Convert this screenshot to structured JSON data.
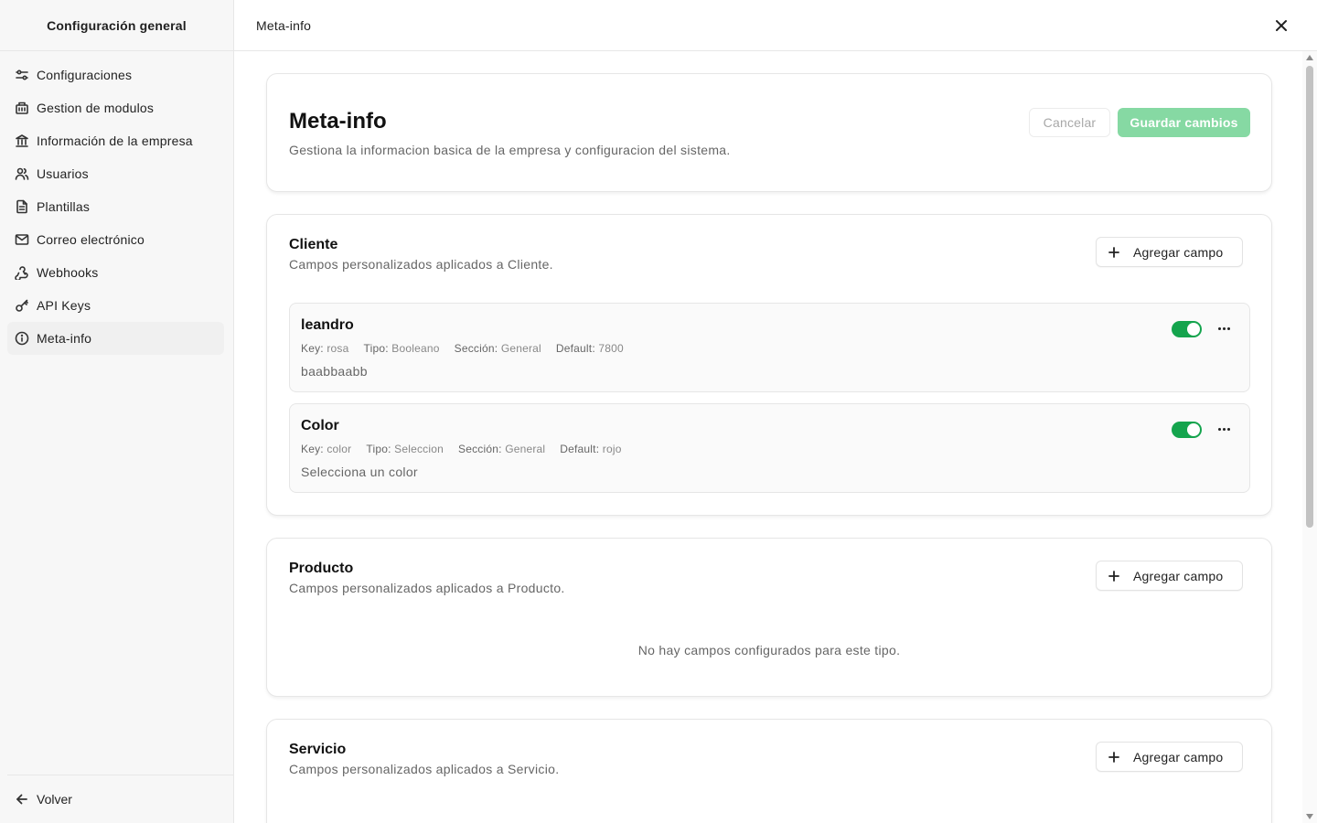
{
  "sidebar": {
    "title": "Configuración general",
    "items": [
      {
        "label": "Configuraciones",
        "icon": "sliders-icon"
      },
      {
        "label": "Gestion de modulos",
        "icon": "modules-icon"
      },
      {
        "label": "Información de la empresa",
        "icon": "bank-icon"
      },
      {
        "label": "Usuarios",
        "icon": "users-icon"
      },
      {
        "label": "Plantillas",
        "icon": "file-text-icon"
      },
      {
        "label": "Correo electrónico",
        "icon": "mail-icon"
      },
      {
        "label": "Webhooks",
        "icon": "webhook-icon"
      },
      {
        "label": "API Keys",
        "icon": "key-icon"
      },
      {
        "label": "Meta-info",
        "icon": "info-icon",
        "active": true
      }
    ],
    "back_label": "Volver"
  },
  "topbar": {
    "title": "Meta-info"
  },
  "header": {
    "title": "Meta-info",
    "subtitle": "Gestiona la informacion basica de la empresa y configuracion del sistema.",
    "cancel_label": "Cancelar",
    "save_label": "Guardar cambios"
  },
  "colors": {
    "toggle_on": "#14a44d",
    "save_button": "#86d9a3"
  },
  "sections": [
    {
      "title": "Cliente",
      "subtitle": "Campos personalizados aplicados a Cliente.",
      "add_label": "Agregar campo",
      "fields": [
        {
          "name": "leandro",
          "key_label": "Key:",
          "key": "rosa",
          "type_label": "Tipo:",
          "type": "Booleano",
          "section_label": "Sección:",
          "section": "General",
          "default_label": "Default:",
          "default": "7800",
          "description": "baabbaabb",
          "enabled": true
        },
        {
          "name": "Color",
          "key_label": "Key:",
          "key": "color",
          "type_label": "Tipo:",
          "type": "Seleccion",
          "section_label": "Sección:",
          "section": "General",
          "default_label": "Default:",
          "default": "rojo",
          "description": "Selecciona un color",
          "enabled": true
        }
      ]
    },
    {
      "title": "Producto",
      "subtitle": "Campos personalizados aplicados a Producto.",
      "add_label": "Agregar campo",
      "empty_message": "No hay campos configurados para este tipo."
    },
    {
      "title": "Servicio",
      "subtitle": "Campos personalizados aplicados a Servicio.",
      "add_label": "Agregar campo"
    }
  ]
}
